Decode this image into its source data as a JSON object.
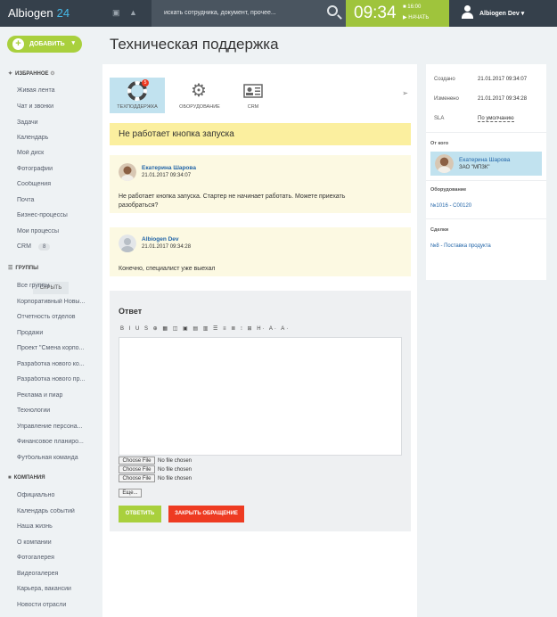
{
  "header": {
    "brand_name": "Albiogen",
    "brand_num": "24",
    "search_placeholder": "искать сотрудника, документ, прочее...",
    "clock_time": "09:34",
    "clock_sub1": "16:00",
    "clock_sub2": "НАЧАТЬ",
    "user_name": "Albiogen Dev"
  },
  "sidebar": {
    "add_label": "ДОБАВИТЬ",
    "favorites_title": "ИЗБРАННОЕ",
    "favorites": [
      "Живая лента",
      "Чат и звонки",
      "Задачи",
      "Календарь",
      "Мой диск",
      "Фотографии",
      "Сообщения",
      "Почта",
      "Бизнес-процессы",
      "Мои процессы",
      "CRM"
    ],
    "crm_badge": "8",
    "groups_title": "ГРУППЫ",
    "hide_label": "СКРЫТЬ",
    "groups": [
      "Все группы",
      "Корпоративный Новы...",
      "Отчетность отделов",
      "Продажи",
      "Проект \"Смена корпо...",
      "Разработка нового ко...",
      "Разработка нового пр...",
      "Реклама и пиар",
      "Технологии",
      "Управление персона...",
      "Финансовое планиро...",
      "Футбольная команда"
    ],
    "company_title": "КОМПАНИЯ",
    "company": [
      "Официально",
      "Календарь событий",
      "Наша жизнь",
      "О компании",
      "Фотогалерея",
      "Видеогалерея",
      "Карьера, вакансии",
      "Новости отрасли"
    ]
  },
  "page": {
    "title": "Техническая поддержка"
  },
  "tabs": [
    {
      "label": "ТЕХПОДДЕРЖКА",
      "badge": "5"
    },
    {
      "label": "ОБОРУДОВАНИЕ"
    },
    {
      "label": "CRM"
    }
  ],
  "ticket": {
    "title": "Не работает кнопка запуска"
  },
  "messages": [
    {
      "author": "Екатерина Шарова",
      "date": "21.01.2017 09:34:07",
      "text": "Не работает кнопка запуска. Стартер не начинает работать. Можете приехать разобраться?"
    },
    {
      "author": "Albiogen Dev",
      "date": "21.01.2017 09:34:28",
      "text": "Конечно, специалист уже выехал"
    }
  ],
  "reply": {
    "heading": "Ответ",
    "toolbar": "B I U S ⊕ ▦ ◫ ▣ ▤ ▥ ☰ ≡ ≣ ⁝ ⊞ H· A· A·",
    "file_button": "Choose File",
    "file_status": "No file chosen",
    "more_label": "Еще...",
    "answer_label": "ОТВЕТИТЬ",
    "close_label": "ЗАКРЫТЬ ОБРАЩЕНИЕ"
  },
  "details": {
    "created_label": "Создано",
    "created_value": "21.01.2017 09:34:07",
    "changed_label": "Изменено",
    "changed_value": "21.01.2017 09:34:28",
    "sla_label": "SLA",
    "sla_value": "По умолчанию",
    "from_label": "От кого",
    "contact_name": "Екатерина Шарова",
    "contact_company": "ЗАО \"МПЗК\"",
    "equipment_label": "Оборудование",
    "equipment_value": "№1016 - C00120",
    "deals_label": "Сделки",
    "deals_value": "№8 - Поставка продукта"
  },
  "colors": {
    "topbar": "#35404b",
    "accent_green": "#a9d03d",
    "clock_green": "#9fc43c",
    "close_red": "#ee3b22",
    "link_blue": "#2265a8",
    "active_tab": "#c1e2ef",
    "banner_yellow": "#fbef9f"
  }
}
